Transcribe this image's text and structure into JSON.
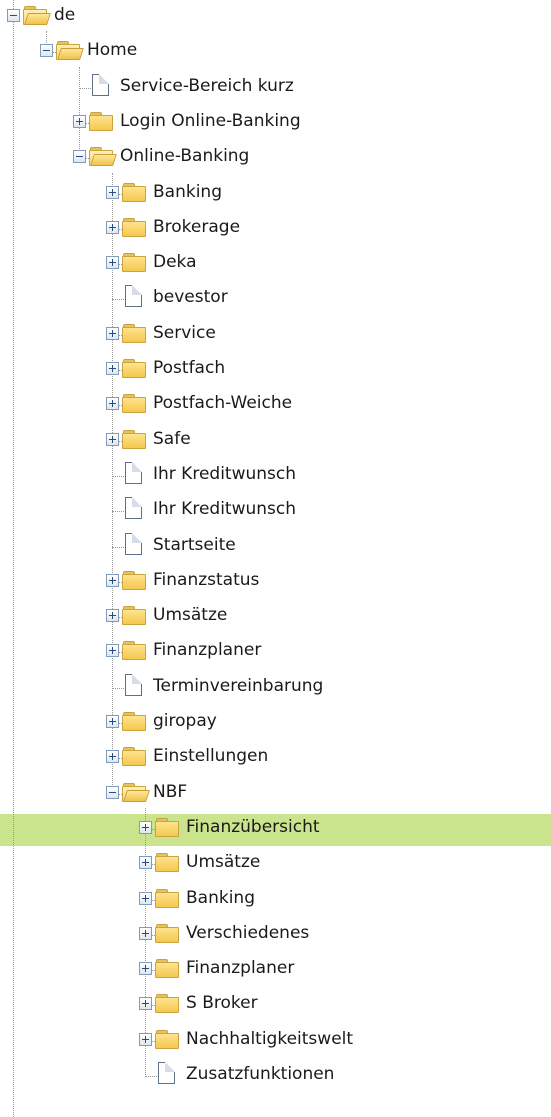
{
  "tree": {
    "nodes": [
      {
        "label": "de",
        "kind": "folder",
        "state": "expanded",
        "depth": 0
      },
      {
        "label": "Home",
        "kind": "folder",
        "state": "expanded",
        "depth": 1
      },
      {
        "label": "Service-Bereich kurz",
        "kind": "page",
        "depth": 2
      },
      {
        "label": "Login Online-Banking",
        "kind": "folder",
        "state": "collapsed",
        "depth": 2
      },
      {
        "label": "Online-Banking",
        "kind": "folder",
        "state": "expanded",
        "depth": 2
      },
      {
        "label": "Banking",
        "kind": "folder",
        "state": "collapsed",
        "depth": 3
      },
      {
        "label": "Brokerage",
        "kind": "folder",
        "state": "collapsed",
        "depth": 3
      },
      {
        "label": "Deka",
        "kind": "folder",
        "state": "collapsed",
        "depth": 3
      },
      {
        "label": "bevestor",
        "kind": "page",
        "depth": 3
      },
      {
        "label": "Service",
        "kind": "folder",
        "state": "collapsed",
        "depth": 3
      },
      {
        "label": "Postfach",
        "kind": "folder",
        "state": "collapsed",
        "depth": 3
      },
      {
        "label": "Postfach-Weiche",
        "kind": "folder",
        "state": "collapsed",
        "depth": 3
      },
      {
        "label": "Safe",
        "kind": "folder",
        "state": "collapsed",
        "depth": 3
      },
      {
        "label": "Ihr Kreditwunsch",
        "kind": "page",
        "depth": 3
      },
      {
        "label": "Ihr Kreditwunsch",
        "kind": "page",
        "depth": 3
      },
      {
        "label": "Startseite",
        "kind": "page",
        "depth": 3
      },
      {
        "label": "Finanzstatus",
        "kind": "folder",
        "state": "collapsed",
        "depth": 3
      },
      {
        "label": "Umsätze",
        "kind": "folder",
        "state": "collapsed",
        "depth": 3
      },
      {
        "label": "Finanzplaner",
        "kind": "folder",
        "state": "collapsed",
        "depth": 3
      },
      {
        "label": "Terminvereinbarung",
        "kind": "page",
        "depth": 3
      },
      {
        "label": "giropay",
        "kind": "folder",
        "state": "collapsed",
        "depth": 3
      },
      {
        "label": "Einstellungen",
        "kind": "folder",
        "state": "collapsed",
        "depth": 3
      },
      {
        "label": "NBF",
        "kind": "folder",
        "state": "expanded",
        "depth": 3
      },
      {
        "label": "Finanzübersicht",
        "kind": "folder",
        "state": "collapsed",
        "depth": 4,
        "selected": true
      },
      {
        "label": "Umsätze",
        "kind": "folder",
        "state": "collapsed",
        "depth": 4
      },
      {
        "label": "Banking",
        "kind": "folder",
        "state": "collapsed",
        "depth": 4
      },
      {
        "label": "Verschiedenes",
        "kind": "folder",
        "state": "collapsed",
        "depth": 4
      },
      {
        "label": "Finanzplaner",
        "kind": "folder",
        "state": "collapsed",
        "depth": 4
      },
      {
        "label": "S Broker",
        "kind": "folder",
        "state": "collapsed",
        "depth": 4
      },
      {
        "label": "Nachhaltigkeitswelt",
        "kind": "folder",
        "state": "collapsed",
        "depth": 4
      },
      {
        "label": "Zusatzfunktionen",
        "kind": "page",
        "depth": 4
      }
    ]
  },
  "colors": {
    "selection": "#c9e48c",
    "folder": "#f4c84f",
    "connector": "#9a9a9a"
  }
}
